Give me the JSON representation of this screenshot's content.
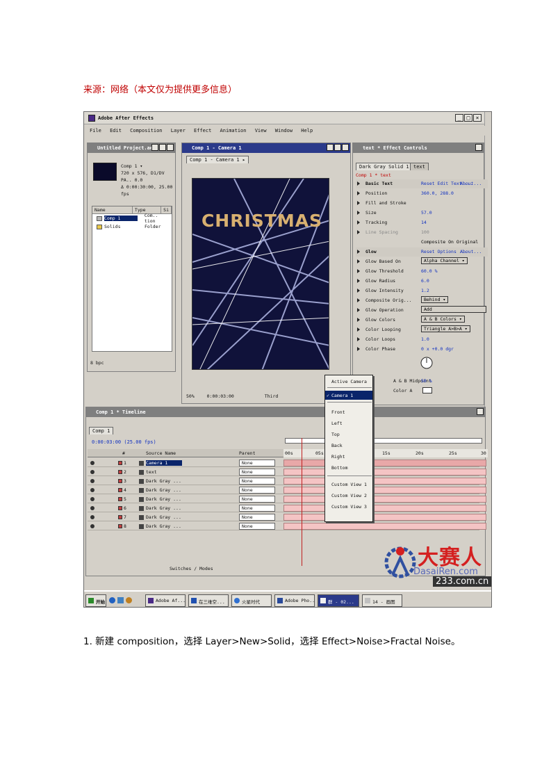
{
  "document": {
    "source_note": "来源：网络（本文仅为提供更多信息）",
    "caption": "1. 新建 composition，选择 Layer>New>Solid，选择 Effect>Noise>Fractal Noise。"
  },
  "screenshot": {
    "app_title": "Adobe After Effects",
    "menu": [
      "File",
      "Edit",
      "Composition",
      "Layer",
      "Effect",
      "Animation",
      "View",
      "Window",
      "Help"
    ],
    "project": {
      "title": "Untitled Project.aep",
      "comp_name": "Comp 1 ▾",
      "comp_info_1": "720 x 576, D1/DV PA.. 0.0",
      "comp_info_2": "Δ 0:00:30:00, 25.00 fps",
      "columns": [
        "Name",
        "Type",
        "Si"
      ],
      "items": [
        {
          "name": "Comp 1",
          "type": "Com.. tion"
        },
        {
          "name": "Solids",
          "type": "Folder"
        }
      ],
      "footer": "8 bpc"
    },
    "comp_window": {
      "title": "Comp 1 - Camera 1",
      "tab": "Comp 1 - Camera 1 ▸",
      "render_text": "CHRISTMAS",
      "zoom": "50%",
      "timecode": "0:00:03:00",
      "resolution": "Third"
    },
    "effect_controls": {
      "title": "text * Effect Controls",
      "tabs": [
        "Dark Gray Solid 1",
        "text"
      ],
      "subtitle": "Comp 1 * text",
      "rows": [
        {
          "name": "Basic Text",
          "val": "Reset  Edit Text ...",
          "extra": "About..."
        },
        {
          "name": "Position",
          "val": "360.0, 288.0"
        },
        {
          "name": "Fill and Stroke",
          "val": ""
        },
        {
          "name": "Size",
          "val": "57.0"
        },
        {
          "name": "Tracking",
          "val": "14"
        },
        {
          "name": "Line Spacing",
          "val": "100"
        },
        {
          "name": "",
          "val": "Composite On Original"
        },
        {
          "name": "Glow",
          "val": "Reset  Options ...",
          "extra": "About..."
        },
        {
          "name": "Glow Based On",
          "val": "Alpha Channel ▾"
        },
        {
          "name": "Glow Threshold",
          "val": "60.0 %"
        },
        {
          "name": "Glow Radius",
          "val": "6.0"
        },
        {
          "name": "Glow Intensity",
          "val": "1.2"
        },
        {
          "name": "Composite Orig...",
          "val": "Behind ▾"
        },
        {
          "name": "Glow Operation",
          "val": "Add"
        },
        {
          "name": "Glow Colors",
          "val": "A & B Colors ▾"
        },
        {
          "name": "Color Looping",
          "val": "Triangle A>B>A ▾"
        },
        {
          "name": "Color Loops",
          "val": "1.0"
        },
        {
          "name": "Color Phase",
          "val": "0 x +0.0 dgr"
        }
      ],
      "ab_midpoint_label": "A & B Midpoint",
      "ab_midpoint_val": "50 %",
      "color_a_label": "Color A"
    },
    "context_menu": {
      "items": [
        "Active Camera",
        "Camera 1",
        "Front",
        "Left",
        "Top",
        "Back",
        "Right",
        "Bottom",
        "Custom View 1",
        "Custom View 2",
        "Custom View 3"
      ],
      "checked": "Camera 1"
    },
    "timeline": {
      "title": "Comp 1 * Timeline",
      "tab": "Comp 1",
      "timecode": "0:00:03:00",
      "fps": "(25.00 fps)",
      "columns": [
        "#",
        "Source Name",
        "Parent"
      ],
      "ruler": [
        "00s",
        "05s",
        "10s",
        "15s",
        "20s",
        "25s",
        "30"
      ],
      "layers": [
        {
          "num": "1",
          "name": "Camera 1",
          "parent": "None"
        },
        {
          "num": "2",
          "name": "text",
          "parent": "None"
        },
        {
          "num": "3",
          "name": "Dark Gray ...",
          "parent": "None"
        },
        {
          "num": "4",
          "name": "Dark Gray ...",
          "parent": "None"
        },
        {
          "num": "5",
          "name": "Dark Gray ...",
          "parent": "None"
        },
        {
          "num": "6",
          "name": "Dark Gray ...",
          "parent": "None"
        },
        {
          "num": "7",
          "name": "Dark Gray ...",
          "parent": "None"
        },
        {
          "num": "8",
          "name": "Dark Gray ...",
          "parent": "None"
        }
      ],
      "footer": "Switches / Modes"
    },
    "taskbar": {
      "start": "开始",
      "buttons": [
        "Adobe Af...",
        "在三维空...",
        "火星时代",
        "Adobe Pho...",
        "群 - 02...",
        "14 - 画图"
      ]
    },
    "watermark": {
      "logo_text": "大赛人",
      "url": "DasaiRen.com",
      "url2": "233.com.cn"
    }
  }
}
